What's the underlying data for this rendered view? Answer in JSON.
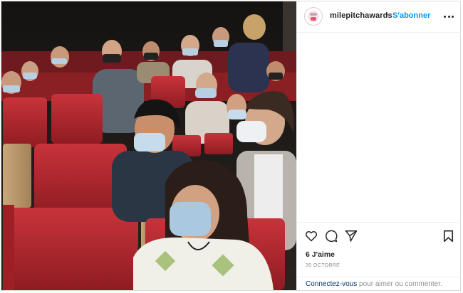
{
  "post": {
    "username": "milepitchawards",
    "separator": "•",
    "follow_label": "S'abonner",
    "likes_text": "6 J'aime",
    "date_text": "30 OCTOBRE",
    "login_link_label": "Connectez-vous",
    "login_suffix": " pour aimer ou commenter."
  },
  "icons": {
    "avatar": "brand-logo",
    "more": "more-options-icon",
    "like": "heart-icon",
    "comment": "comment-icon",
    "share": "share-icon",
    "save": "bookmark-icon"
  },
  "colors": {
    "accent": "#0095f6",
    "link": "#00376b",
    "seat_red": "#b5252c",
    "muted_text": "#8e8e8e"
  }
}
